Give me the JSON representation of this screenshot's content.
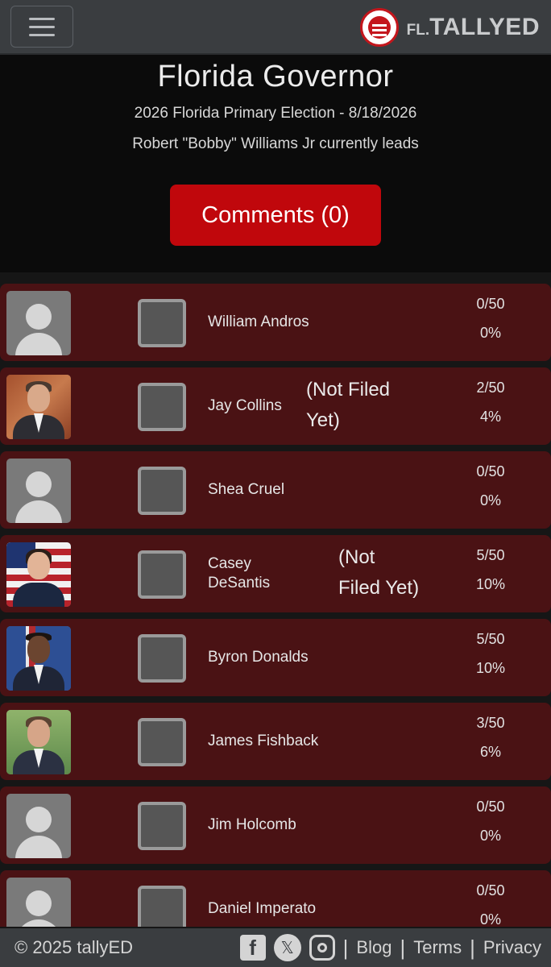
{
  "header": {
    "menu_icon": "hamburger-menu-icon",
    "brand_prefix": "FL.",
    "brand_name": "TALLYED",
    "logo_icon": "tallyed-seal-logo",
    "brand_color": "#c4161c"
  },
  "race": {
    "title": "Florida Governor",
    "subtitle": "2026 Florida Primary Election - 8/18/2026",
    "leader_text": "Robert \"Bobby\" Williams Jr currently leads",
    "comments_label": "Comments (0)"
  },
  "candidates": [
    {
      "name": "William Andros",
      "note": "",
      "votes": "0/50",
      "percent": "0%",
      "photo": "placeholder"
    },
    {
      "name": "Jay Collins",
      "note_line1": "(Not Filed",
      "note_line2": "Yet)",
      "votes": "2/50",
      "percent": "4%",
      "photo": "portrait"
    },
    {
      "name": "Shea Cruel",
      "note": "",
      "votes": "0/50",
      "percent": "0%",
      "photo": "placeholder"
    },
    {
      "name_line1": "Casey",
      "name_line2": "DeSantis",
      "note_line1": "(Not",
      "note_line2": "Filed Yet)",
      "votes": "5/50",
      "percent": "10%",
      "photo": "portrait"
    },
    {
      "name": "Byron Donalds",
      "note": "",
      "votes": "5/50",
      "percent": "10%",
      "photo": "portrait"
    },
    {
      "name": "James Fishback",
      "note": "",
      "votes": "3/50",
      "percent": "6%",
      "photo": "portrait"
    },
    {
      "name": "Jim Holcomb",
      "note": "",
      "votes": "0/50",
      "percent": "0%",
      "photo": "placeholder"
    },
    {
      "name": "Daniel Imperato",
      "note": "",
      "votes": "0/50",
      "percent": "0%",
      "photo": "placeholder"
    }
  ],
  "footer": {
    "copyright": "© 2025 tallyED",
    "facebook_icon": "facebook-icon",
    "x_icon": "x-twitter-icon",
    "instagram_icon": "instagram-icon",
    "links": [
      "Blog",
      "Terms",
      "Privacy"
    ]
  },
  "colors": {
    "accent": "#c0070c",
    "row_bg": "#4a1214",
    "bar_bg": "#3a3d40"
  }
}
